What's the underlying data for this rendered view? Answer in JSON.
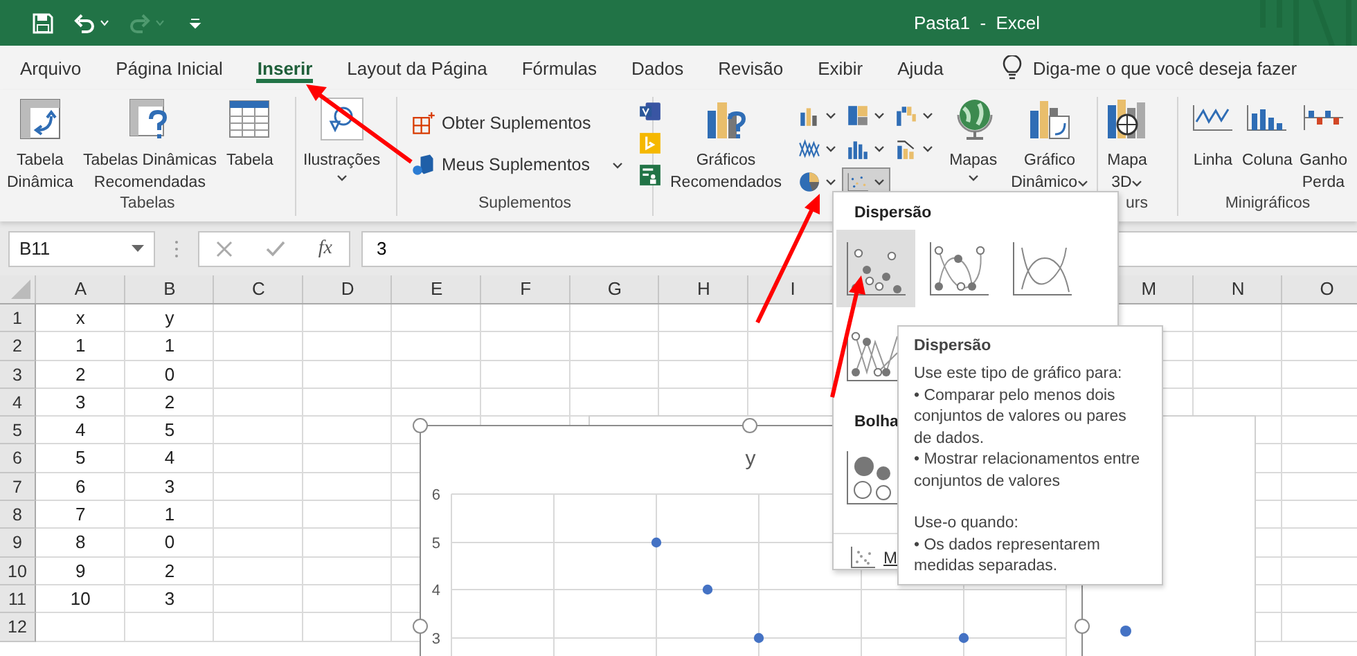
{
  "window": {
    "title": "Pasta1  -  Excel"
  },
  "quick_access": [
    {
      "kind": "save",
      "disabled": false
    },
    {
      "kind": "undo",
      "disabled": false
    },
    {
      "kind": "redo",
      "disabled": true
    },
    {
      "kind": "customize",
      "disabled": false
    }
  ],
  "tabs": [
    {
      "label": "Arquivo",
      "selected": false
    },
    {
      "label": "Página Inicial",
      "selected": false
    },
    {
      "label": "Inserir",
      "selected": true
    },
    {
      "label": "Layout da Página",
      "selected": false
    },
    {
      "label": "Fórmulas",
      "selected": false
    },
    {
      "label": "Dados",
      "selected": false
    },
    {
      "label": "Revisão",
      "selected": false
    },
    {
      "label": "Exibir",
      "selected": false
    },
    {
      "label": "Ajuda",
      "selected": false
    }
  ],
  "tell_me": {
    "placeholder": "Diga-me o que você deseja fazer"
  },
  "ribbon": {
    "tables": {
      "label": "Tabelas",
      "buttons": [
        {
          "kind": "pivot",
          "label": "Tabela\nDinâmica"
        },
        {
          "kind": "recommended-pivot",
          "label": "Tabelas Dinâmicas\nRecomendadas"
        },
        {
          "kind": "table",
          "label": "Tabela"
        }
      ]
    },
    "illustrations": {
      "kind": "illustrations",
      "label": "Ilustrações",
      "dropdown": true
    },
    "addins": {
      "label": "Suplementos",
      "buttons": [
        {
          "kind": "get",
          "label": "Obter Suplementos",
          "caret": false
        },
        {
          "kind": "mine",
          "label": "Meus Suplementos",
          "caret": true
        }
      ],
      "small": [
        {
          "kind": "visio"
        },
        {
          "kind": "bing"
        },
        {
          "kind": "people"
        }
      ]
    },
    "charts": {
      "recommended": {
        "kind": "recommended-charts",
        "label": "Gráficos\nRecomendados"
      },
      "types": [
        {
          "kind": "column",
          "selected": false
        },
        {
          "kind": "hierarchy",
          "selected": false
        },
        {
          "kind": "waterfall",
          "selected": false
        },
        {
          "kind": "line",
          "selected": false
        },
        {
          "kind": "statistic",
          "selected": false
        },
        {
          "kind": "combo",
          "selected": false
        },
        {
          "kind": "pie",
          "selected": false
        },
        {
          "kind": "scatter",
          "selected": true
        }
      ],
      "buttons": [
        {
          "kind": "maps",
          "label": "Mapas",
          "dropdown": true
        },
        {
          "kind": "pivot-chart",
          "label": "Gráfico\nDinâmico",
          "dropdown": true
        }
      ]
    },
    "tours": {
      "label": "urs",
      "button": {
        "kind": "map3d",
        "label": "Mapa\n3D",
        "dropdown": true
      }
    },
    "sparklines": {
      "label": "Minigráficos",
      "buttons": [
        {
          "kind": "spark-line",
          "label": "Linha"
        },
        {
          "kind": "spark-column",
          "label": "Coluna"
        },
        {
          "kind": "spark-winloss",
          "label": "Ganho\nPerda"
        }
      ]
    }
  },
  "formula_bar": {
    "name_box": "B11",
    "function_label": "fx",
    "value": "3"
  },
  "sheet": {
    "columns": [
      "A",
      "B",
      "C",
      "D",
      "E",
      "F",
      "G",
      "H",
      "I",
      "M",
      "N",
      "O"
    ],
    "rows": [
      {
        "number": "1",
        "cells": [
          "x",
          "y"
        ]
      },
      {
        "number": "2",
        "cells": [
          "1",
          "1"
        ]
      },
      {
        "number": "3",
        "cells": [
          "2",
          "0"
        ]
      },
      {
        "number": "4",
        "cells": [
          "3",
          "2"
        ]
      },
      {
        "number": "5",
        "cells": [
          "4",
          "5"
        ]
      },
      {
        "number": "6",
        "cells": [
          "5",
          "4"
        ]
      },
      {
        "number": "7",
        "cells": [
          "6",
          "3"
        ]
      },
      {
        "number": "8",
        "cells": [
          "7",
          "1"
        ]
      },
      {
        "number": "9",
        "cells": [
          "8",
          "0"
        ]
      },
      {
        "number": "10",
        "cells": [
          "9",
          "2"
        ]
      },
      {
        "number": "11",
        "cells": [
          "10",
          "3"
        ]
      },
      {
        "number": "12"
      }
    ]
  },
  "chart": {
    "title": "y",
    "y_axis_labels": [
      "6",
      "5",
      "4",
      "3"
    ]
  },
  "scatter_menu": {
    "sections": [
      {
        "title": "Dispersão",
        "options": [
          {
            "kind": "markers",
            "selected": true
          },
          {
            "kind": "smooth-markers",
            "selected": false
          },
          {
            "kind": "smooth-lines",
            "selected": false
          },
          {
            "kind": "straight-markers",
            "selected": false
          }
        ]
      },
      {
        "title": "Bolha",
        "options": [
          {
            "kind": "bubble",
            "selected": false
          }
        ]
      }
    ],
    "more_link": "M"
  },
  "tooltip": {
    "title": "Dispersão",
    "paragraphs": [
      "Use este tipo de gráfico para:\n• Comparar pelo menos dois conjuntos de valores ou pares de dados.\n• Mostrar relacionamentos entre conjuntos de valores",
      "Use-o quando:\n• Os dados representarem medidas separadas."
    ]
  }
}
